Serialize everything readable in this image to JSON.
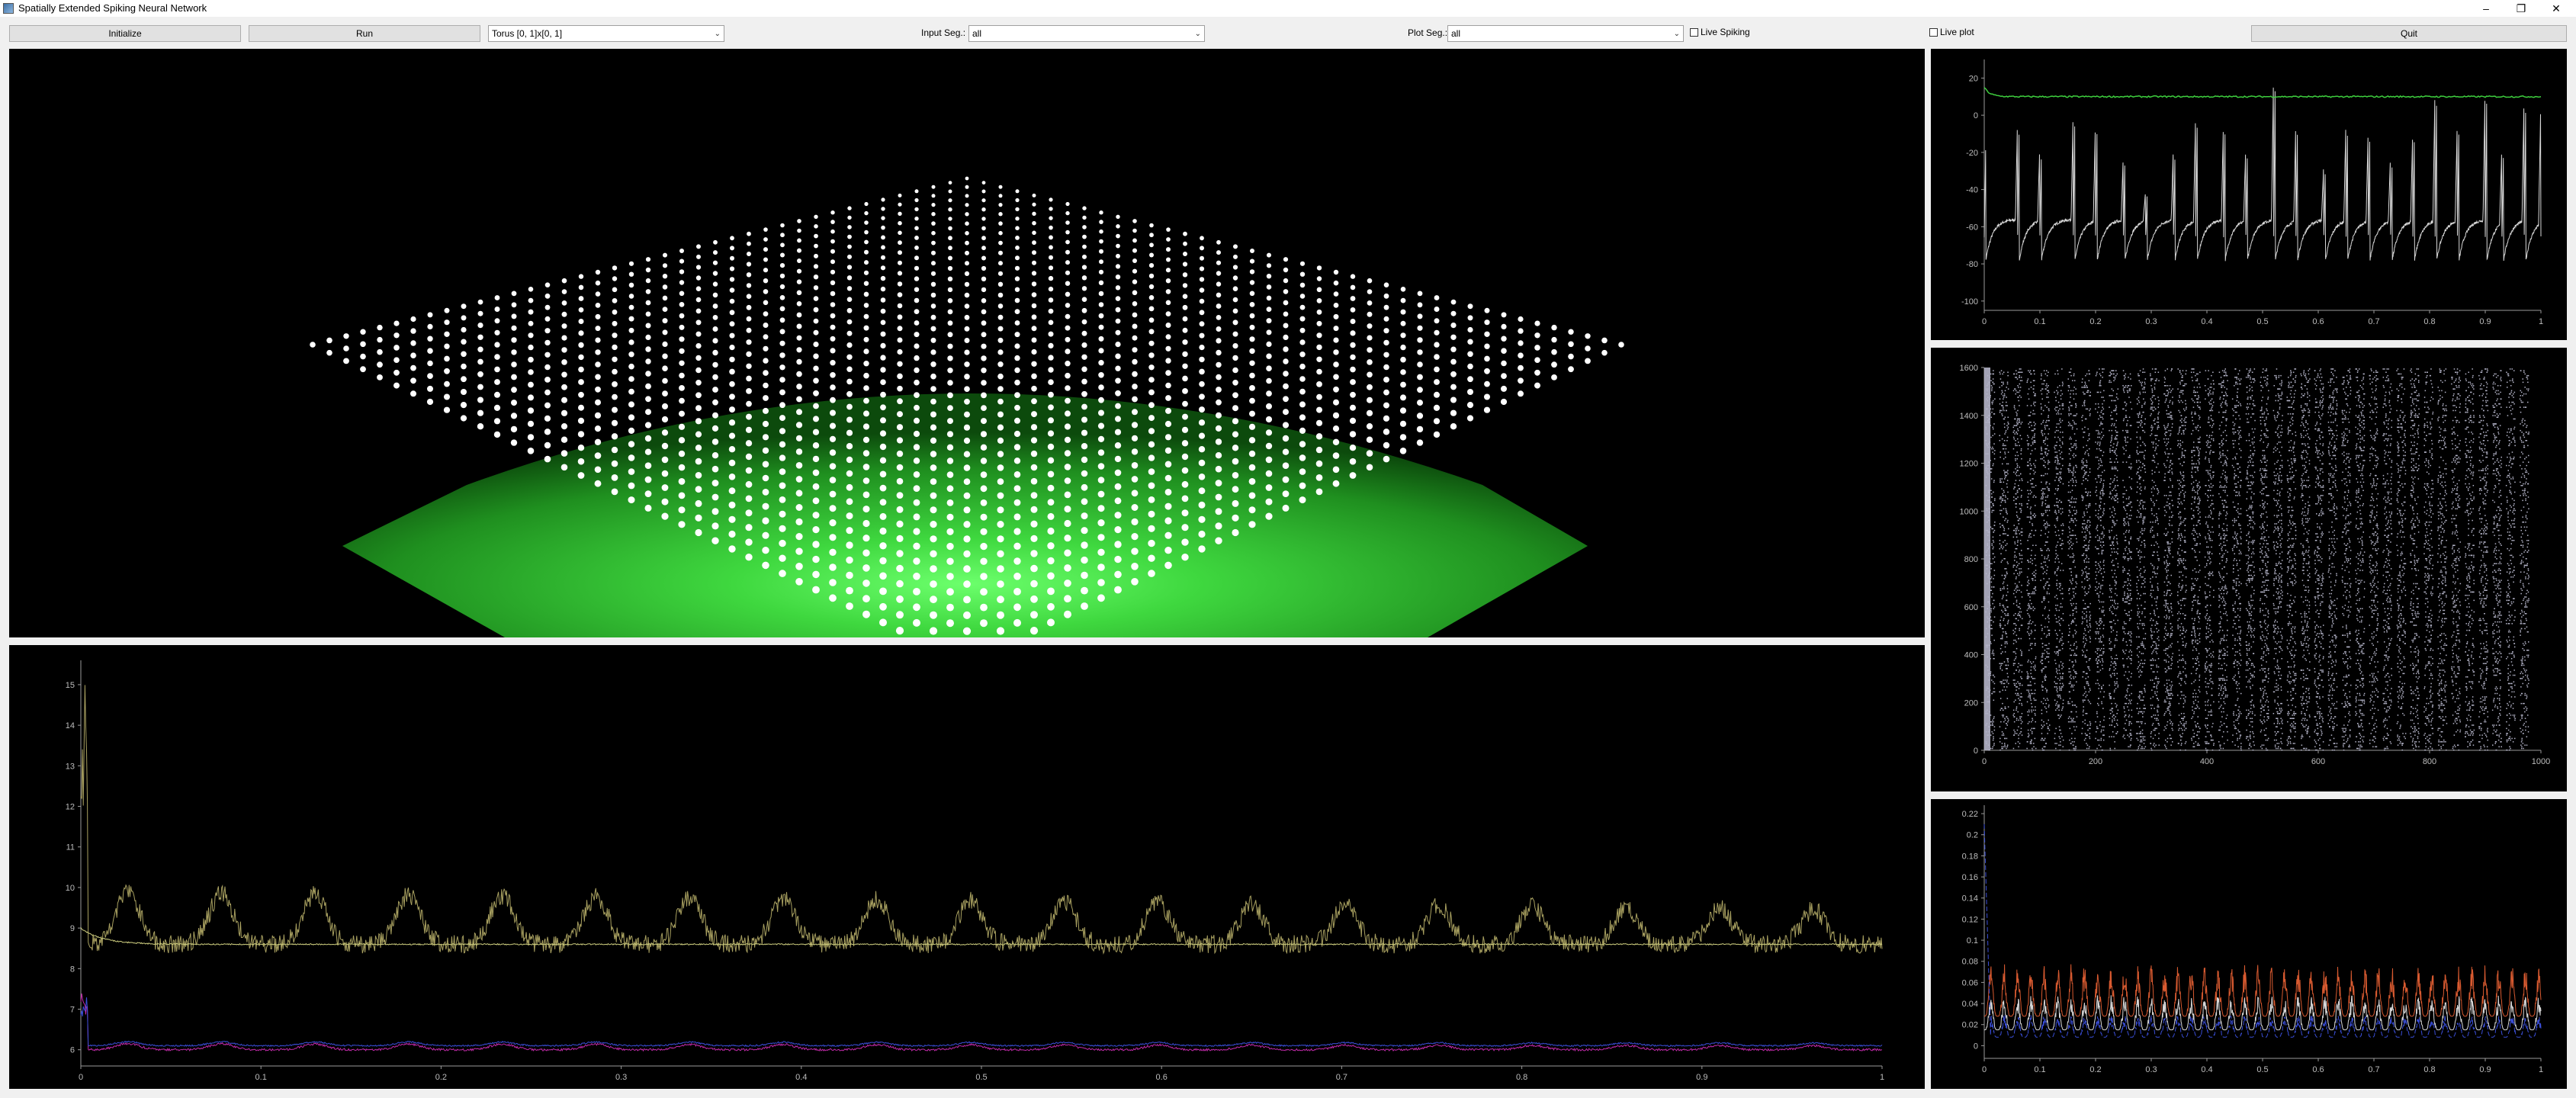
{
  "window": {
    "title": "Spatially Extended Spiking Neural Network",
    "controls": [
      "–",
      "❐",
      "✕"
    ]
  },
  "toolbar": {
    "initialize_label": "Initialize",
    "run_label": "Run",
    "topology_value": "Torus [0, 1]x[0, 1]",
    "input_seg_label": "Input Seg.:",
    "input_seg_value": "all",
    "plot_seg_label": "Plot Seg.:",
    "plot_seg_value": "all",
    "live_spiking_label": "Live Spiking",
    "live_plot_label": "Live plot",
    "quit_label": "Quit"
  },
  "colors": {
    "surface_green": "#3cd23c",
    "neuron_dots": "#ffffff",
    "voltage_trace": "#d8d8d8",
    "mean_trace": "#3ecf3e",
    "raster": "#b4b4c8",
    "olive_series": "#a8a060",
    "magenta_series": "#c02aa8",
    "orange_series": "#d85a30",
    "blue_series": "#3a4ed8"
  },
  "chart_data": [
    {
      "type": "line",
      "panel": "voltage",
      "x_ticks": [
        "0",
        "0.1",
        "0.2",
        "0.3",
        "0.4",
        "0.5",
        "0.6",
        "0.7",
        "0.8",
        "0.9",
        "1"
      ],
      "y_ticks": [
        "20",
        "0",
        "-20",
        "-40",
        "-60",
        "-80",
        "-100"
      ],
      "xlim": [
        0,
        1
      ],
      "ylim": [
        -105,
        30
      ],
      "spike_times": [
        0.0,
        0.06,
        0.1,
        0.16,
        0.2,
        0.25,
        0.29,
        0.34,
        0.38,
        0.43,
        0.47,
        0.52,
        0.56,
        0.61,
        0.65,
        0.69,
        0.73,
        0.77,
        0.81,
        0.85,
        0.9,
        0.93,
        0.97,
        1.0
      ],
      "spike_peaks": [
        -10,
        0,
        -15,
        5,
        0,
        -20,
        -40,
        -15,
        5,
        0,
        -15,
        28,
        0,
        -25,
        0,
        -5,
        -20,
        -5,
        20,
        0,
        20,
        -15,
        15,
        10
      ],
      "series": [
        {
          "name": "",
          "baseline": 10,
          "start": 15
        }
      ]
    },
    {
      "type": "scatter",
      "panel": "raster",
      "x_ticks": [
        "0",
        "200",
        "400",
        "600",
        "800",
        "1000"
      ],
      "y_ticks": [
        "1600",
        "1400",
        "1200",
        "1000",
        "800",
        "600",
        "400",
        "200",
        "0"
      ],
      "xlim": [
        0,
        1000
      ],
      "ylim": [
        0,
        1600
      ],
      "neuron_count": 1600
    },
    {
      "type": "line",
      "panel": "population-means",
      "x_ticks": [
        "0",
        "0.1",
        "0.2",
        "0.3",
        "0.4",
        "0.5",
        "0.6",
        "0.7",
        "0.8",
        "0.9",
        "1"
      ],
      "y_ticks": [
        "15",
        "14",
        "13",
        "12",
        "11",
        "10",
        "9",
        "8",
        "7",
        "6"
      ],
      "xlim": [
        0,
        1
      ],
      "ylim": [
        5.6,
        15.6
      ],
      "series": [
        {
          "name": "",
          "color": "#a8a060",
          "mean": 8.6,
          "peak": 15.3,
          "osc_amp": 1.3,
          "period": 0.052
        },
        {
          "name": "",
          "color": "#d0d080",
          "mean": 8.6,
          "start": 9.0
        },
        {
          "name": "",
          "color": "#c02aa8",
          "mean": 6.0,
          "peak": 7.6,
          "osc_amp": 0.15,
          "period": 0.052
        },
        {
          "name": "",
          "color": "#3a4ed8",
          "mean": 6.1,
          "peak": 7.3,
          "osc_amp": 0.1,
          "period": 0.052
        }
      ]
    },
    {
      "type": "line",
      "panel": "rates",
      "x_ticks": [
        "0",
        "0.1",
        "0.2",
        "0.3",
        "0.4",
        "0.5",
        "0.6",
        "0.7",
        "0.8",
        "0.9",
        "1"
      ],
      "y_ticks": [
        "0.22",
        "0.2",
        "0.18",
        "0.16",
        "0.14",
        "0.12",
        "0.1",
        "0.08",
        "0.06",
        "0.04",
        "0.02",
        "0"
      ],
      "xlim": [
        0,
        1
      ],
      "ylim": [
        -0.012,
        0.228
      ],
      "series": [
        {
          "name": "",
          "color": "#d85a30",
          "base": 0.028,
          "amp": 0.045,
          "period": 0.024
        },
        {
          "name": "",
          "color": "#d8d8d8",
          "base": 0.015,
          "amp": 0.03,
          "period": 0.024
        },
        {
          "name": "",
          "color": "#3a4ed8",
          "base": 0.008,
          "amp": 0.02,
          "period": 0.024,
          "start_peak": 0.21
        }
      ]
    }
  ]
}
